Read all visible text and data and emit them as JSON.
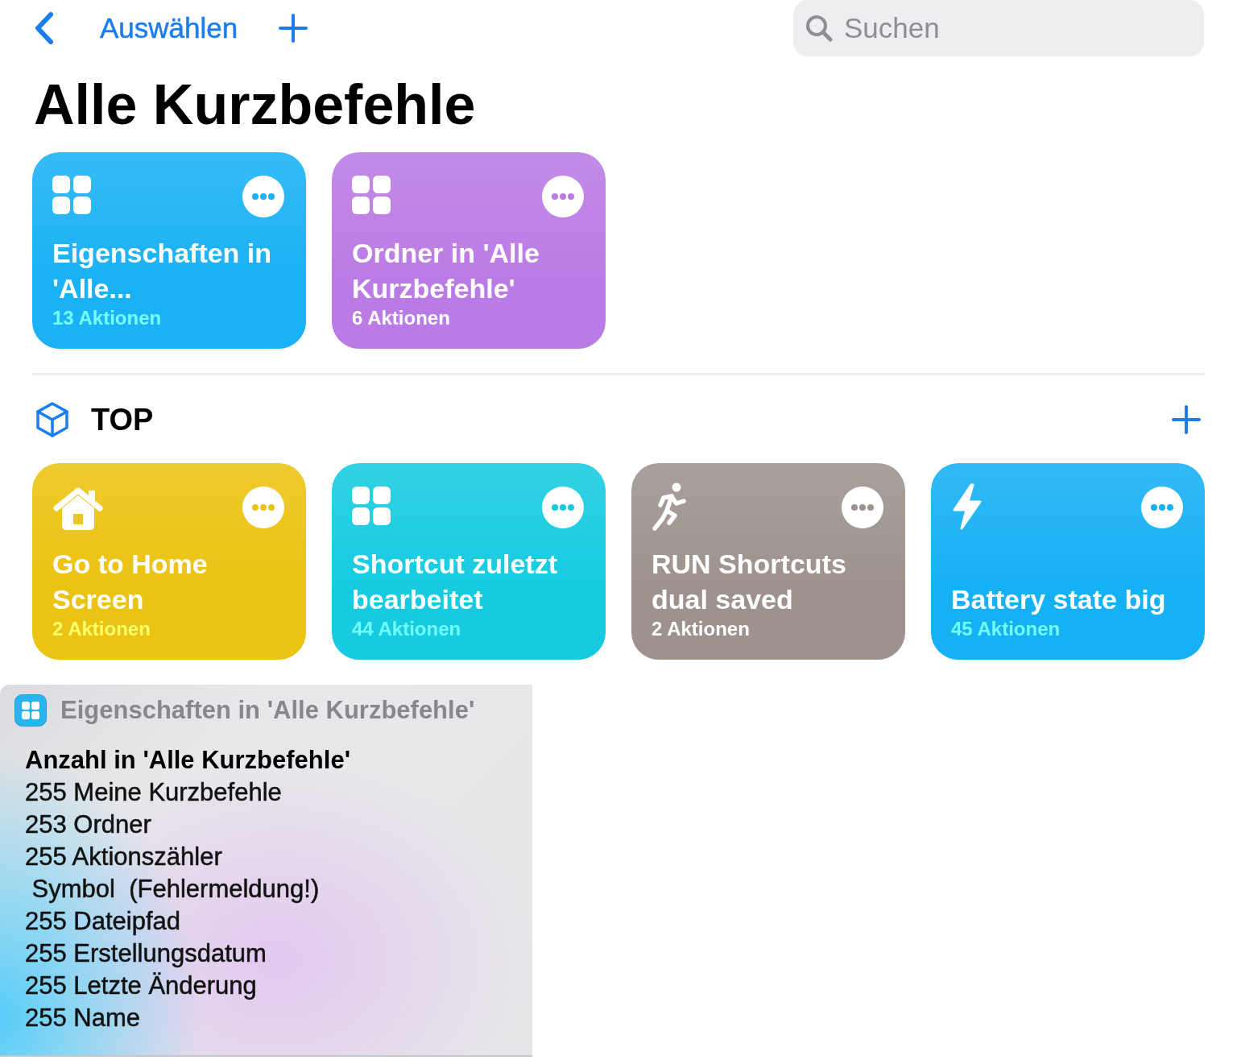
{
  "toolbar": {
    "select_label": "Auswählen",
    "search": {
      "placeholder": "Suchen"
    }
  },
  "title": "Alle Kurzbefehle",
  "pinned": [
    {
      "kind": "grid",
      "color": "#1ab2f5",
      "title": "Eigenschaften in 'Alle...",
      "subtitle": "13 Aktionen"
    },
    {
      "kind": "grid",
      "color": "#bb7be5",
      "title": "Ordner in 'Alle Kurzbefehle'",
      "subtitle": "6 Aktionen"
    }
  ],
  "section": {
    "title": "TOP",
    "shortcuts": [
      {
        "kind": "house",
        "color": "#ebc312",
        "title": "Go to Home Screen",
        "subtitle": "2 Aktionen"
      },
      {
        "kind": "grid",
        "color": "#16cbe0",
        "title": "Shortcut zuletzt bearbeitet",
        "subtitle": "44 Aktionen"
      },
      {
        "kind": "runner",
        "color": "#9d928e",
        "title": "RUN Shortcuts dual saved",
        "subtitle": "2 Aktionen"
      },
      {
        "kind": "bolt",
        "color": "#16b0f5",
        "title": "Battery state big",
        "subtitle": "45 Aktionen"
      }
    ]
  },
  "result": {
    "title": "Eigenschaften in 'Alle Kurzbefehle'",
    "heading": "Anzahl in 'Alle Kurzbefehle'",
    "lines": [
      "255 Meine Kurzbefehle",
      "253 Ordner",
      "255 Aktionszähler",
      " Symbol  (Fehlermeldung!)",
      "255 Dateipfad",
      "255 Erstellungsdatum",
      "255 Letzte Änderung",
      "255 Name"
    ]
  }
}
